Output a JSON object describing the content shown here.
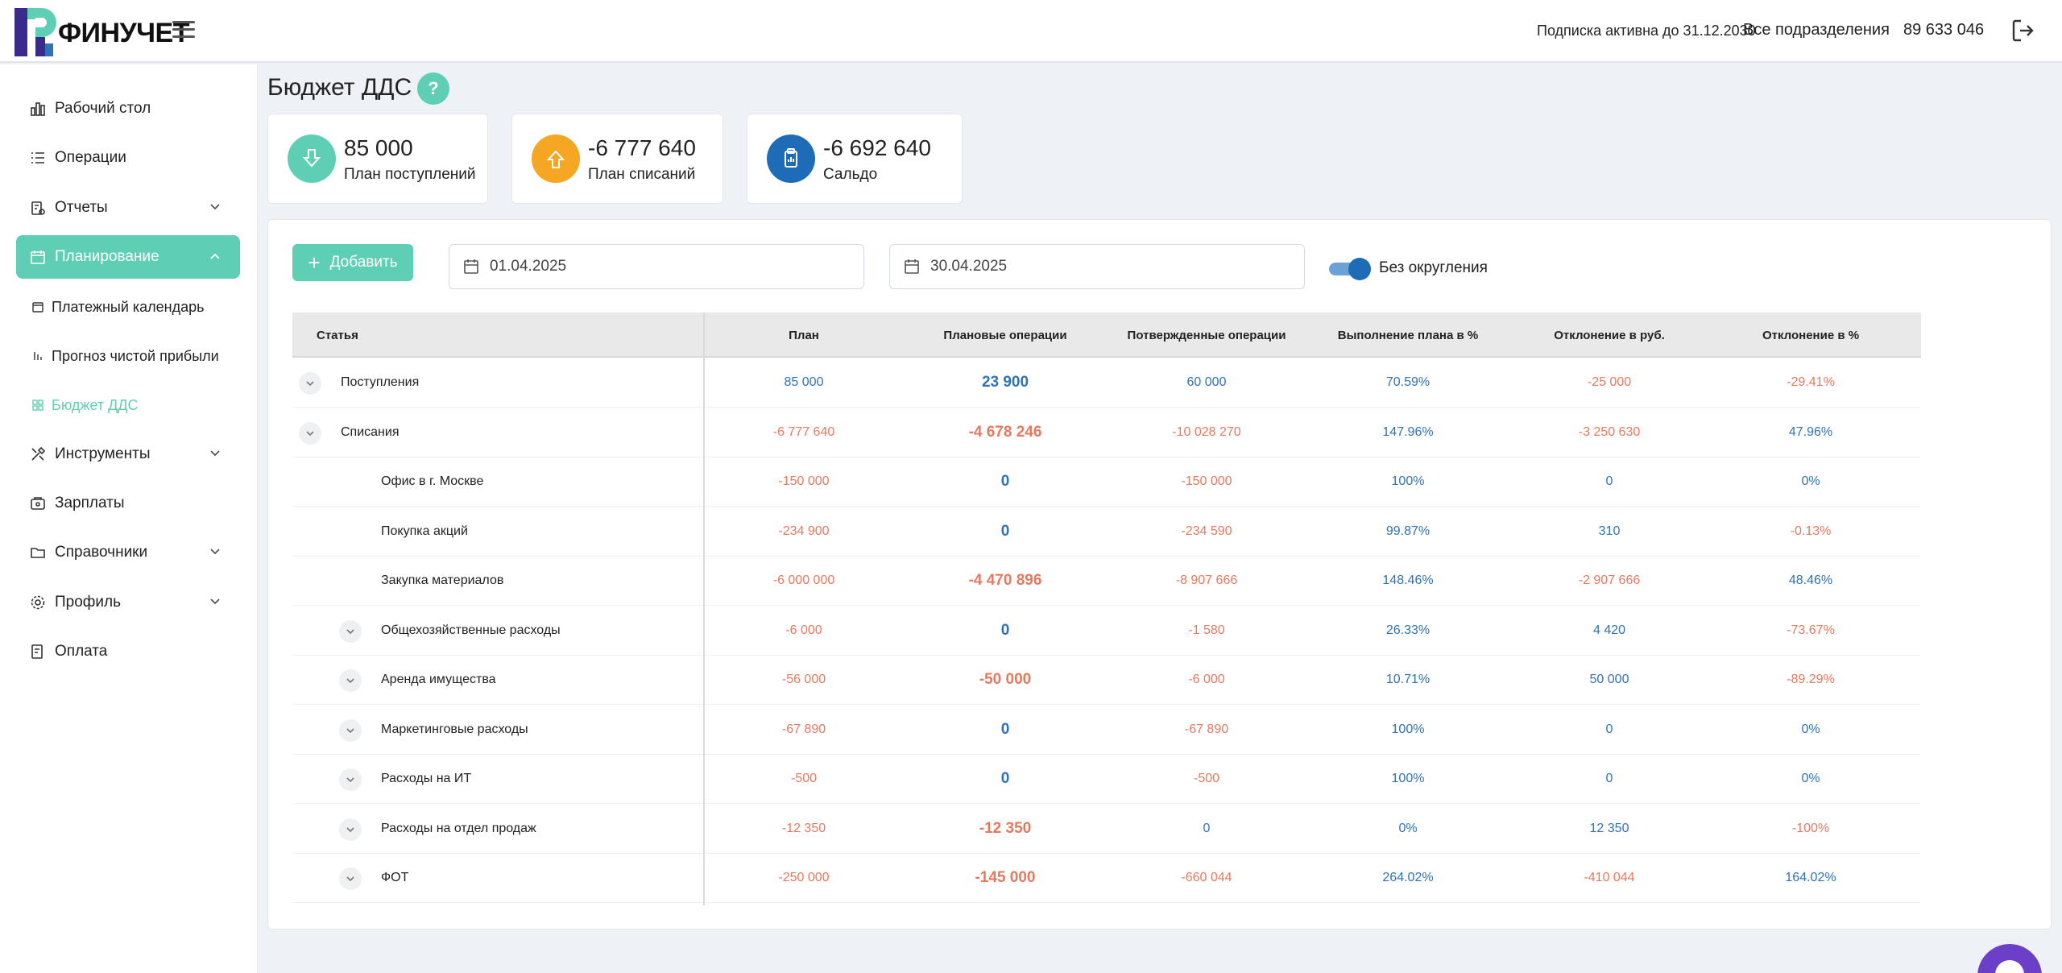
{
  "brand": {
    "name": "ФИНУЧЕТ",
    "colors": {
      "accent": "#5ecfb5",
      "blue": "#2f72b8",
      "negative": "#e8795e",
      "logo_purple": "#3a2a8c",
      "logo_teal": "#5ecfb5"
    }
  },
  "header": {
    "subscription": "Подписка активна до 31.12.2030",
    "department": "Все подразделения",
    "phone": "89 633 046"
  },
  "sidebar": {
    "items": [
      {
        "label": "Рабочий стол",
        "icon": "chart-bar-icon"
      },
      {
        "label": "Операции",
        "icon": "list-icon"
      },
      {
        "label": "Отчеты",
        "icon": "report-icon"
      },
      {
        "label": "Планирование",
        "icon": "calendar-icon"
      },
      {
        "label": "Инструменты",
        "icon": "tools-icon"
      },
      {
        "label": "Зарплаты",
        "icon": "wallet-icon"
      },
      {
        "label": "Справочники",
        "icon": "folder-icon"
      },
      {
        "label": "Профиль",
        "icon": "gear-icon"
      },
      {
        "label": "Оплата",
        "icon": "receipt-icon"
      }
    ],
    "sub_items": [
      {
        "label": "Платежный календарь"
      },
      {
        "label": "Прогноз чистой прибыли"
      },
      {
        "label": "Бюджет ДДС"
      }
    ]
  },
  "page": {
    "title": "Бюджет ДДС",
    "help": "?"
  },
  "stats": [
    {
      "value": "85 000",
      "caption": "План поступлений",
      "color": "#5ecfb5"
    },
    {
      "value": "-6 777 640",
      "caption": "План списаний",
      "color": "#f5a623"
    },
    {
      "value": "-6 692 640",
      "caption": "Сальдо",
      "color": "#1e6bb8"
    }
  ],
  "toolbar": {
    "add_label": "Добавить",
    "date_from": "01.04.2025",
    "date_to": "30.04.2025",
    "rounding_label": "Без округления"
  },
  "table": {
    "headers": [
      "Статья",
      "План",
      "Плановые операции",
      "Потвержденные операции",
      "Выполнение плана в %",
      "Отклонение в руб.",
      "Отклонение в %"
    ],
    "rows": [
      {
        "name": "Поступления",
        "plan": "85 000",
        "planned_ops": "23 900",
        "confirmed": "60 000",
        "exec": "70.59%",
        "dev_rub": "-25 000",
        "dev_pct": "-29.41%"
      },
      {
        "name": "Списания",
        "plan": "-6 777 640",
        "planned_ops": "-4 678 246",
        "confirmed": "-10 028 270",
        "exec": "147.96%",
        "dev_rub": "-3 250 630",
        "dev_pct": "47.96%"
      },
      {
        "name": "Офис в г. Москве",
        "plan": "-150 000",
        "planned_ops": "0",
        "confirmed": "-150 000",
        "exec": "100%",
        "dev_rub": "0",
        "dev_pct": "0%"
      },
      {
        "name": "Покупка акций",
        "plan": "-234 900",
        "planned_ops": "0",
        "confirmed": "-234 590",
        "exec": "99.87%",
        "dev_rub": "310",
        "dev_pct": "-0.13%"
      },
      {
        "name": "Закупка материалов",
        "plan": "-6 000 000",
        "planned_ops": "-4 470 896",
        "confirmed": "-8 907 666",
        "exec": "148.46%",
        "dev_rub": "-2 907 666",
        "dev_pct": "48.46%"
      },
      {
        "name": "Общехозяйственные расходы",
        "plan": "-6 000",
        "planned_ops": "0",
        "confirmed": "-1 580",
        "exec": "26.33%",
        "dev_rub": "4 420",
        "dev_pct": "-73.67%"
      },
      {
        "name": "Аренда имущества",
        "plan": "-56 000",
        "planned_ops": "-50 000",
        "confirmed": "-6 000",
        "exec": "10.71%",
        "dev_rub": "50 000",
        "dev_pct": "-89.29%"
      },
      {
        "name": "Маркетинговые расходы",
        "plan": "-67 890",
        "planned_ops": "0",
        "confirmed": "-67 890",
        "exec": "100%",
        "dev_rub": "0",
        "dev_pct": "0%"
      },
      {
        "name": "Расходы на ИТ",
        "plan": "-500",
        "planned_ops": "0",
        "confirmed": "-500",
        "exec": "100%",
        "dev_rub": "0",
        "dev_pct": "0%"
      },
      {
        "name": "Расходы на отдел продаж",
        "plan": "-12 350",
        "planned_ops": "-12 350",
        "confirmed": "0",
        "exec": "0%",
        "dev_rub": "12 350",
        "dev_pct": "-100%"
      },
      {
        "name": "ФОТ",
        "plan": "-250 000",
        "planned_ops": "-145 000",
        "confirmed": "-660 044",
        "exec": "264.02%",
        "dev_rub": "-410 044",
        "dev_pct": "164.02%"
      }
    ]
  }
}
